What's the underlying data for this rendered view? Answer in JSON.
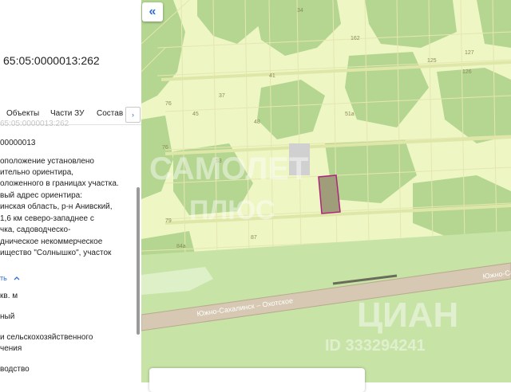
{
  "panel": {
    "cadastral_number": "65:05:0000013:262",
    "tabs": [
      "Объекты",
      "Части ЗУ",
      "Состав"
    ],
    "cutoff_line": "65:05:0000013:262",
    "quarter": "00000013",
    "description_lines": [
      "оположение установлено",
      "ительно ориентира,",
      "оложенного в границах участка.",
      "вый адрес ориентира:",
      "инская область, р-н Анивский,",
      "1,6 км северо-западнее с",
      "чка, садоводческо-",
      "дническое некоммерческое",
      "ищество \"Солнышко\", участок"
    ],
    "link_text": "ть",
    "area_unit": "кв. м",
    "status_text": "ный",
    "category_lines": [
      "и сельскохозяйственного",
      "чения"
    ],
    "usage_text": "водство"
  },
  "map": {
    "road_name": "Южно-Сахалинск – Охотское",
    "road_name_right": "Южно-Са",
    "watermarks": [
      "САМОЛЕТ",
      "ПЛЮС",
      "ЦИАН",
      "ID 333294241"
    ],
    "plot_numbers": [
      {
        "label": "34"
      },
      {
        "label": "162"
      },
      {
        "label": "127"
      },
      {
        "label": "125"
      },
      {
        "label": "126"
      },
      {
        "label": "41"
      },
      {
        "label": "37"
      },
      {
        "label": "76"
      },
      {
        "label": "45"
      },
      {
        "label": "48"
      },
      {
        "label": "51a"
      },
      {
        "label": "53"
      },
      {
        "label": "76"
      },
      {
        "label": "79"
      },
      {
        "label": "84a"
      },
      {
        "label": "87"
      }
    ],
    "colors": {
      "land": "#eef6c4",
      "forest": "#b4d690",
      "field": "#c7e3a6",
      "plot_line": "#e6e6b0",
      "road": "#d6c8b3",
      "highlight_fill": "#9f9d7a",
      "highlight_stroke": "#b0227f"
    }
  },
  "controls": {
    "collapse_icon": "«",
    "tabs_next_icon": "›"
  }
}
